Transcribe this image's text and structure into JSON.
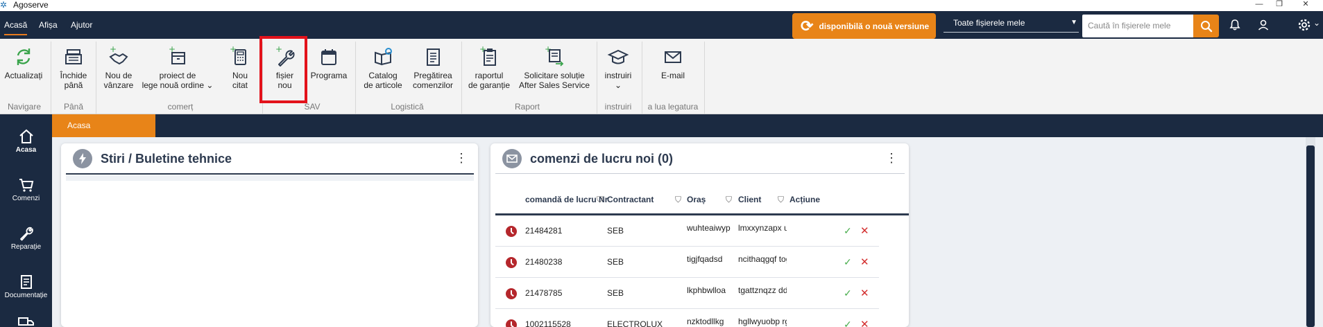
{
  "window": {
    "title": "Agoserve"
  },
  "menu": {
    "items": [
      "Acasă",
      "Afișa",
      "Ajutor"
    ]
  },
  "topbar": {
    "update_label": "disponibilă o nouă versiune",
    "filter_selected": "Toate fișierele mele",
    "search_placeholder": "Caută în fișierele mele"
  },
  "ribbon": {
    "buttons": {
      "refresh": "Actualizați",
      "close": [
        "Închide",
        "până"
      ],
      "sale": [
        "Nou de",
        "vânzare"
      ],
      "project": [
        "proiect de",
        "lege nouă ordine"
      ],
      "quote": [
        "Nou",
        "citat"
      ],
      "new_file": [
        "fișier",
        "nou"
      ],
      "schedule": "Programa",
      "catalog": [
        "Catalog",
        "de articole"
      ],
      "prep": [
        "Pregătirea",
        "comenzilor"
      ],
      "warranty": [
        "raportul",
        "de garanție"
      ],
      "aftersales": [
        "Solicitare soluție",
        "After Sales Service"
      ],
      "training": "instruiri",
      "email": "E-mail"
    },
    "groups": {
      "nav": "Navigare",
      "until": "Până",
      "commerce": "comerț",
      "sav": "SAV",
      "logistics": "Logistică",
      "report": "Raport",
      "training": "instruiri",
      "contact": "a lua legatura"
    }
  },
  "sidebar": {
    "items": [
      "Acasa",
      "Comenzi",
      "Reparație",
      "Documentație"
    ]
  },
  "tabs": {
    "active": "Acasa"
  },
  "news_panel": {
    "title": "Stiri / Buletine tehnice"
  },
  "orders_panel": {
    "title": "comenzi de lucru noi (0)",
    "columns": [
      "comandă de lucru Nr",
      "Contractant",
      "Oraș",
      "Client",
      "Acțiune"
    ],
    "rows": [
      {
        "nr": "21484281",
        "contractor": "SEB",
        "city": "wuhteaiwyp",
        "client": "lmxxynzapx unc"
      },
      {
        "nr": "21480238",
        "contractor": "SEB",
        "city": "tigjfqadsd",
        "client": "ncithaqgqf togh"
      },
      {
        "nr": "21478785",
        "contractor": "SEB",
        "city": "lkphbwlloa",
        "client": "tgattznqzz ddbz"
      },
      {
        "nr": "1002115528",
        "contractor": "ELECTROLUX",
        "city": "nzktodllkg",
        "client": "hgllwyuobp rgx"
      }
    ]
  },
  "colors": {
    "navy": "#1b2a41",
    "accent": "#e88418",
    "highlight": "#e3121b"
  }
}
